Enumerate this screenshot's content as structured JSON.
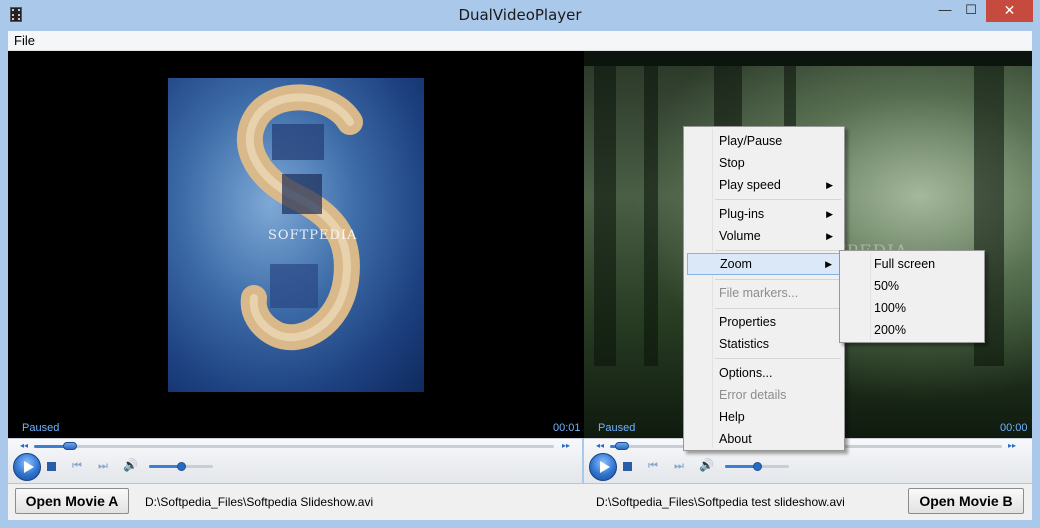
{
  "window": {
    "title": "DualVideoPlayer",
    "minimize_glyph": "—",
    "maximize_glyph": "☐",
    "close_glyph": "✕"
  },
  "menubar": {
    "file": "File"
  },
  "player_a": {
    "status": "Paused",
    "time": "00:01",
    "seek_fraction": 0.07,
    "volume_fraction": 0.5,
    "watermark": "SOFTPEDIA",
    "open_button": "Open Movie A",
    "file_path": "D:\\Softpedia_Files\\Softpedia Slideshow.avi"
  },
  "player_b": {
    "status": "Paused",
    "time": "00:00",
    "seek_fraction": 0.03,
    "volume_fraction": 0.5,
    "watermark": "SOFTPEDIA",
    "open_button": "Open Movie B",
    "file_path": "D:\\Softpedia_Files\\Softpedia test slideshow.avi"
  },
  "context_menu": {
    "items": [
      {
        "label": "Play/Pause"
      },
      {
        "label": "Stop"
      },
      {
        "label": "Play speed"
      },
      {
        "label": "Plug-ins"
      },
      {
        "label": "Volume"
      },
      {
        "label": "Zoom"
      },
      {
        "label": "File markers..."
      },
      {
        "label": "Properties"
      },
      {
        "label": "Statistics"
      },
      {
        "label": "Options..."
      },
      {
        "label": "Error details"
      },
      {
        "label": "Help"
      },
      {
        "label": "About"
      }
    ],
    "submenu_arrow": "▶"
  },
  "zoom_submenu": {
    "items": [
      {
        "label": "Full screen"
      },
      {
        "label": "50%"
      },
      {
        "label": "100%"
      },
      {
        "label": "200%"
      }
    ]
  },
  "icons": {
    "seek_back": "◂◂",
    "seek_fwd": "▸▸",
    "prev": "⏮",
    "next": "⏭",
    "speaker": "🔊"
  }
}
